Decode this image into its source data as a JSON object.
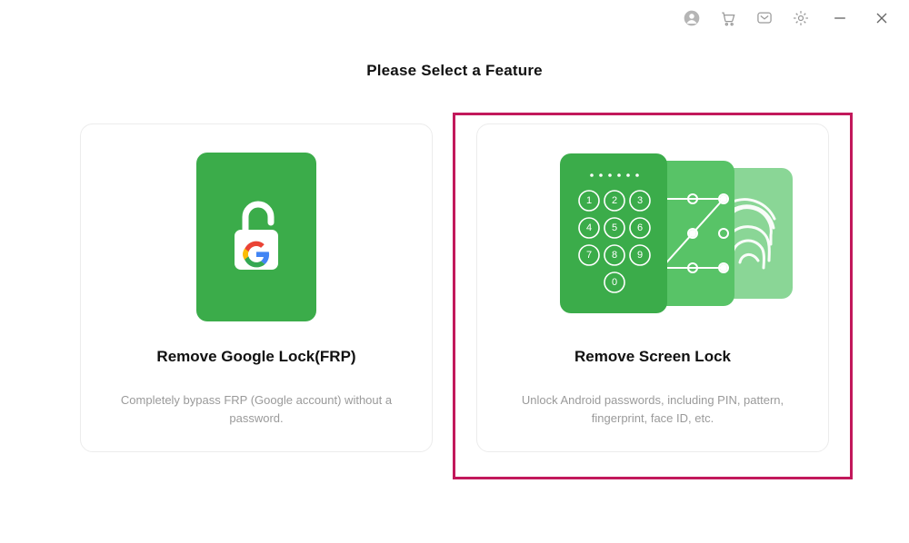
{
  "heading": "Please Select a Feature",
  "cards": {
    "frp": {
      "title": "Remove Google Lock(FRP)",
      "description": "Completely bypass FRP (Google account) without a password."
    },
    "screenlock": {
      "title": "Remove Screen Lock",
      "description": "Unlock Android passwords, including PIN, pattern, fingerprint, face ID, etc."
    }
  },
  "colors": {
    "primary": "#3bac4a"
  }
}
